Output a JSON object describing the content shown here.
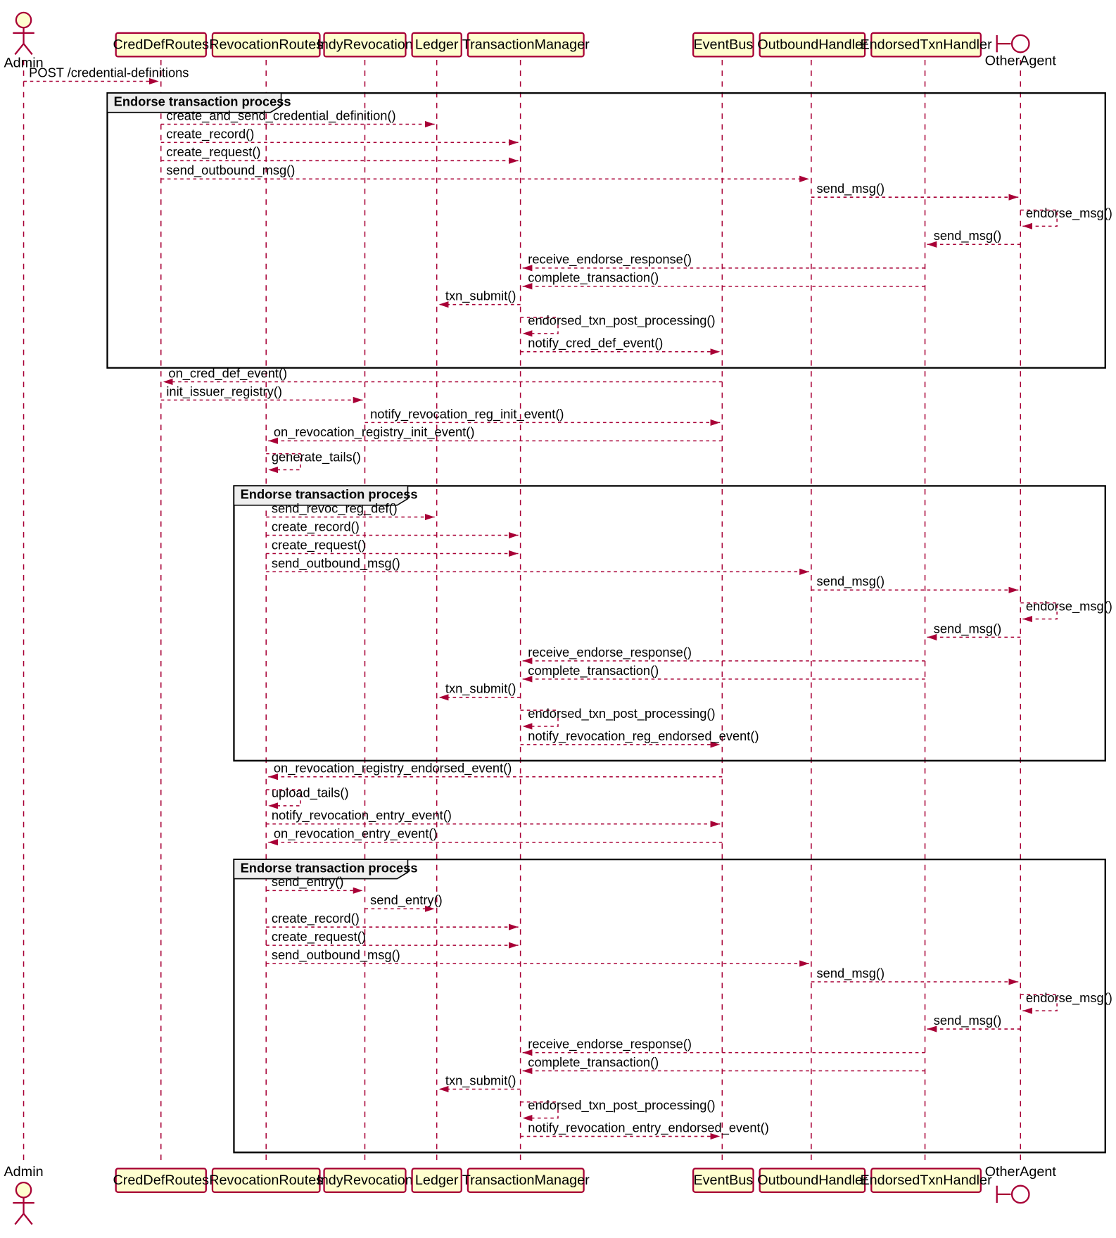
{
  "participants": {
    "admin": "Admin",
    "creddef": "CredDefRoutes",
    "revroutes": "RevocationRoutes",
    "indyrev": "IndyRevocation",
    "ledger": "Ledger",
    "txnmgr": "TransactionManager",
    "eventbus": "EventBus",
    "outbound": "OutboundHandler",
    "endorsed": "EndorsedTxnHandler",
    "other": "OtherAgent"
  },
  "frames": {
    "endorse": "Endorse transaction process"
  },
  "messages": {
    "m1": "POST /credential-definitions",
    "m2": "create_and_send_credential_definition()",
    "m3": "create_record()",
    "m4": "create_request()",
    "m5": "send_outbound_msg()",
    "m6": "send_msg()",
    "m7": "endorse_msg()",
    "m8": "send_msg()",
    "m9": "receive_endorse_response()",
    "m10": "complete_transaction()",
    "m11": "txn_submit()",
    "m12": "endorsed_txn_post_processing()",
    "m13": "notify_cred_def_event()",
    "m14": "on_cred_def_event()",
    "m15": "init_issuer_registry()",
    "m16": "notify_revocation_reg_init_event()",
    "m17": "on_revocation_registry_init_event()",
    "m18": "generate_tails()",
    "m19": "send_revoc_reg_def()",
    "m20": "create_record()",
    "m21": "create_request()",
    "m22": "send_outbound_msg()",
    "m23": "send_msg()",
    "m24": "endorse_msg()",
    "m25": "send_msg()",
    "m26": "receive_endorse_response()",
    "m27": "complete_transaction()",
    "m28": "txn_submit()",
    "m29": "endorsed_txn_post_processing()",
    "m30": "notify_revocation_reg_endorsed_event()",
    "m31": "on_revocation_registry_endorsed_event()",
    "m32": "upload_tails()",
    "m33": "notify_revocation_entry_event()",
    "m34": "on_revocation_entry_event()",
    "m35": "send_entry()",
    "m36": "send_entry()",
    "m37": "create_record()",
    "m38": "create_request()",
    "m39": "send_outbound_msg()",
    "m40": "send_msg()",
    "m41": "endorse_msg()",
    "m42": "send_msg()",
    "m43": "receive_endorse_response()",
    "m44": "complete_transaction()",
    "m45": "txn_submit()",
    "m46": "endorsed_txn_post_processing()",
    "m47": "notify_revocation_entry_endorsed_event()"
  }
}
